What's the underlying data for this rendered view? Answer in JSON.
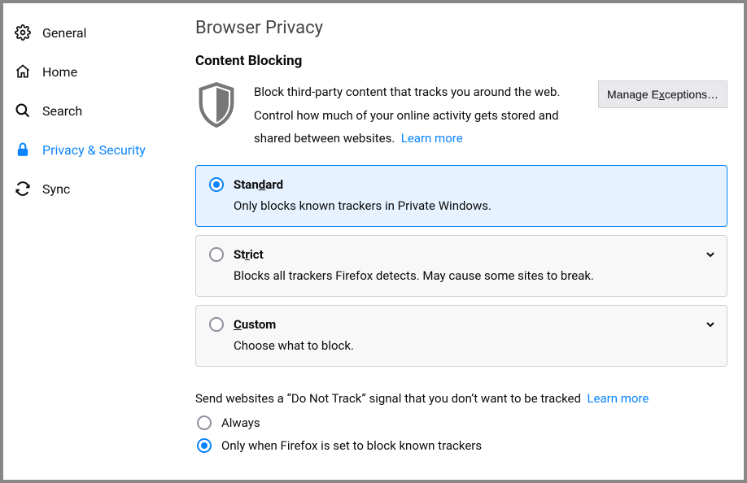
{
  "sidebar": {
    "items": [
      {
        "label": "General",
        "icon": "gear-icon"
      },
      {
        "label": "Home",
        "icon": "home-icon"
      },
      {
        "label": "Search",
        "icon": "search-icon"
      },
      {
        "label": "Privacy & Security",
        "icon": "lock-icon"
      },
      {
        "label": "Sync",
        "icon": "sync-icon"
      }
    ]
  },
  "page": {
    "title": "Browser Privacy"
  },
  "content_blocking": {
    "heading": "Content Blocking",
    "intro": "Block third-party content that tracks you around the web. Control how much of your online activity gets stored and shared between websites.",
    "learn_more": "Learn more",
    "manage_exceptions": "Manage Exceptions…",
    "options": {
      "standard": {
        "title_pre": "Stan",
        "title_u": "d",
        "title_post": "ard",
        "desc": "Only blocks known trackers in Private Windows.",
        "selected": true
      },
      "strict": {
        "title_pre": "St",
        "title_u": "r",
        "title_post": "ict",
        "desc": "Blocks all trackers Firefox detects. May cause some sites to break.",
        "selected": false
      },
      "custom": {
        "title_pre": "",
        "title_u": "C",
        "title_post": "ustom",
        "desc": "Choose what to block.",
        "selected": false
      }
    }
  },
  "dnt": {
    "text": "Send websites a “Do Not Track” signal that you don’t want to be tracked",
    "learn_more": "Learn more",
    "always": "Always",
    "only_when": "Only when Firefox is set to block known trackers",
    "selected": "only_when"
  }
}
